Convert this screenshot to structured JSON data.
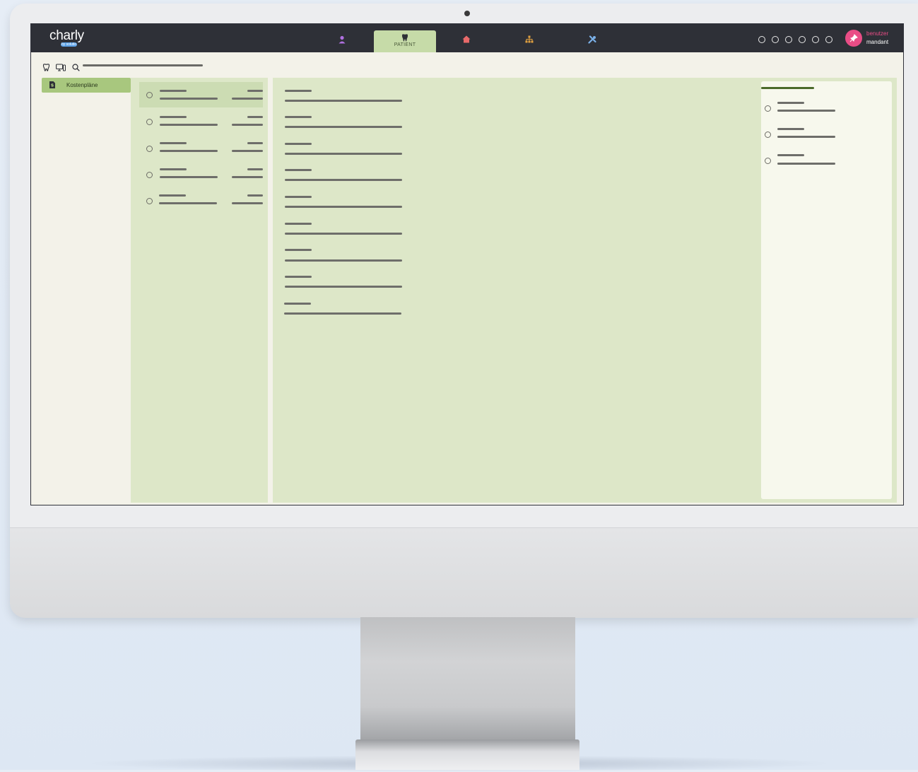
{
  "app": {
    "logo": "charly",
    "logo_sub": "by solutio"
  },
  "nav": {
    "items": [
      {
        "name": "person",
        "icon": "person-icon",
        "color": "#b070e0"
      },
      {
        "name": "patient",
        "icon": "tooth-icon",
        "label": "PATIENT",
        "active": true
      },
      {
        "name": "home",
        "icon": "house-icon",
        "color": "#e96a6a"
      },
      {
        "name": "organization",
        "icon": "org-chart-icon",
        "color": "#e0a040"
      },
      {
        "name": "tools",
        "icon": "tools-icon",
        "color": "#7ab0e8"
      }
    ]
  },
  "user": {
    "name": "benutzer",
    "mandant": "mandant"
  },
  "sidebar": {
    "items": [
      {
        "label": "Kostenpläne",
        "icon": "document-dollar-icon",
        "active": true
      }
    ]
  },
  "colors": {
    "topbar": "#2e3037",
    "accent": "#a8c77e",
    "panel": "#dde7c8",
    "avatar": "#e94d86"
  }
}
